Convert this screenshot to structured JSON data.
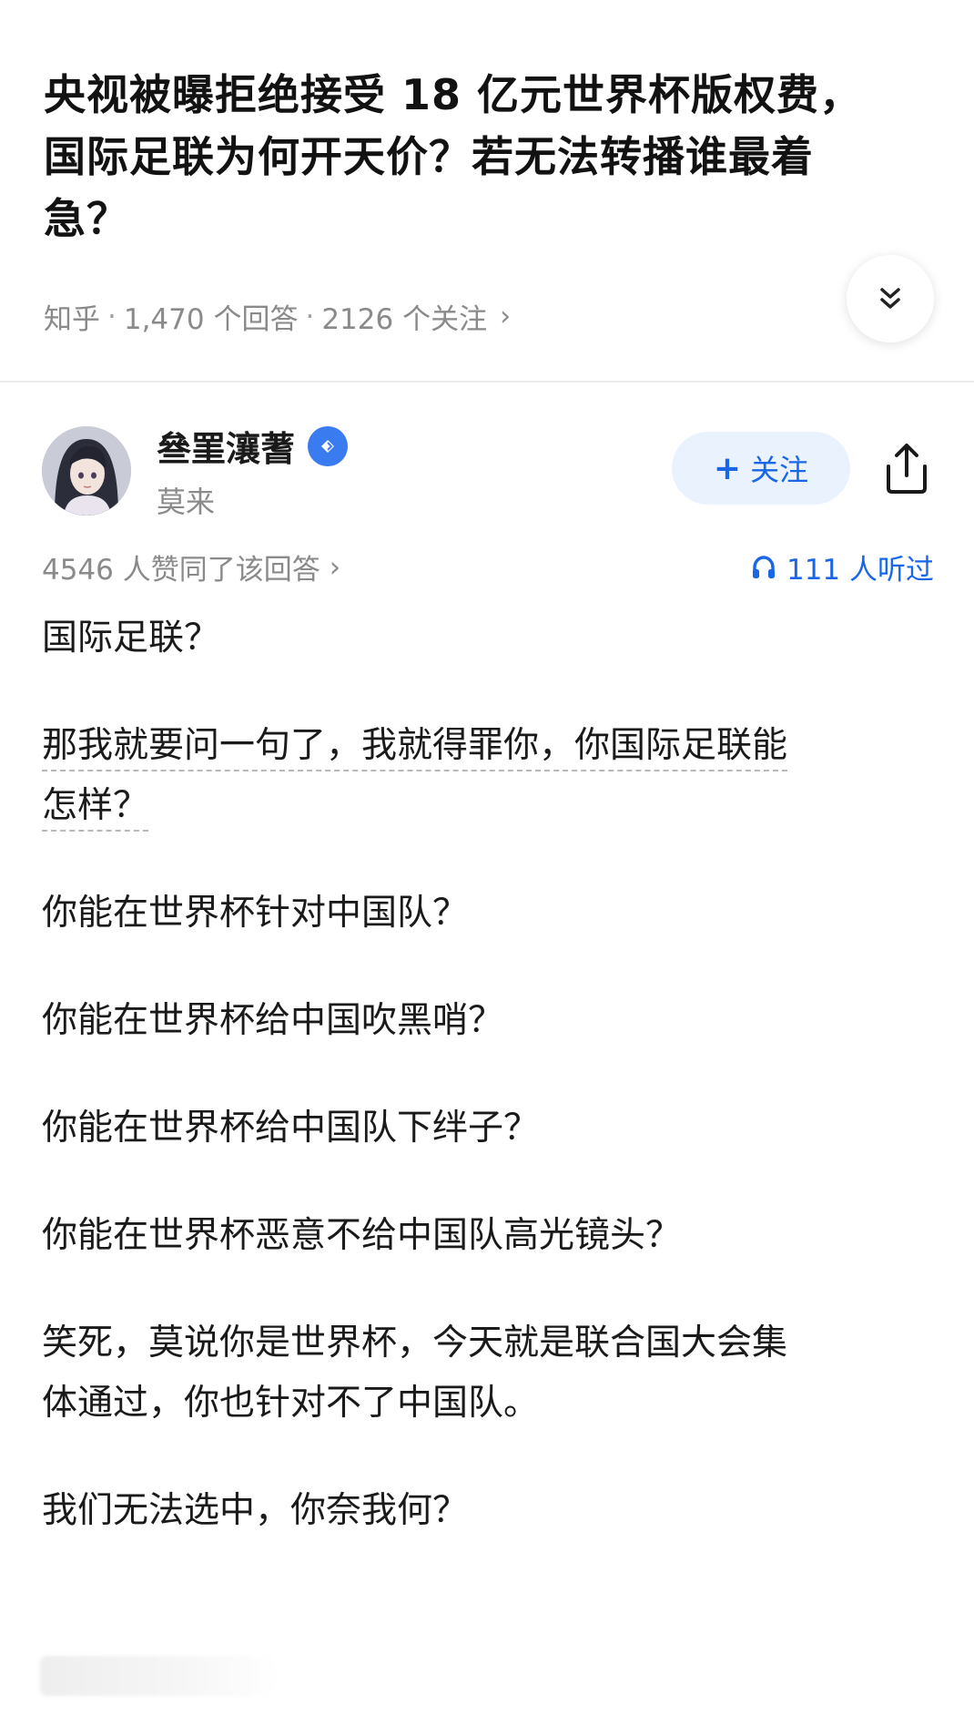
{
  "question": {
    "title_line1": "央视被曝拒绝接受 18 亿元世界杯版权费，",
    "title_line2": "国际足联为何开天价？若无法转播谁最着",
    "title_line3": "急？",
    "source": "知乎",
    "answers": "1,470 个回答",
    "followers": "2126 个关注"
  },
  "author": {
    "name": "叄罣瀼蓍",
    "subtitle": "莫来",
    "follow_label": "关注"
  },
  "stats": {
    "votes": "4546 人赞同了该回答",
    "listened": "111 人听过"
  },
  "answer": {
    "p1": "国际足联？",
    "p2_line1": "那我就要问一句了，我就得罪你，你国际足联能",
    "p2_line2": "怎样？",
    "p3": "你能在世界杯针对中国队？",
    "p4": "你能在世界杯给中国吹黑哨？",
    "p5": "你能在世界杯给中国队下绊子？",
    "p6": "你能在世界杯恶意不给中国队高光镜头？",
    "p7_line1": "笑死，莫说你是世界杯，今天就是联合国大会集",
    "p7_line2": "体通过，你也针对不了中国队。",
    "p8": "我们无法选中，你奈我何？"
  },
  "colors": {
    "accent": "#1967e6",
    "muted": "#8a8a8a",
    "follow_bg": "#eaf2fd"
  },
  "icons": {
    "expand": "double-chevron-down-icon",
    "badge": "verified-badge-icon",
    "share": "share-icon",
    "headphones": "headphones-icon"
  }
}
